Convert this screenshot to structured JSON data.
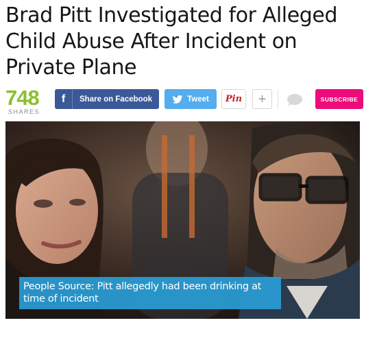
{
  "article": {
    "headline": "Brad Pitt Investigated for Alleged Child Abuse After Incident on Private Plane"
  },
  "share_bar": {
    "count": "748",
    "count_label": "SHARES",
    "facebook_label": "Share on Facebook",
    "facebook_icon": "facebook-f-icon",
    "tweet_label": "Tweet",
    "tweet_icon": "twitter-bird-icon",
    "pin_label": "Pin",
    "plus_label": "+",
    "comment_icon": "comment-bubble-icon",
    "subscribe_label": "SUBSCRIBE",
    "colors": {
      "count": "#8cbf2f",
      "facebook": "#3b5998",
      "twitter": "#55acee",
      "pinterest": "#cb2027",
      "subscribe": "#ec0c7b"
    }
  },
  "video": {
    "caption": "People Source: Pitt allegedly had been drinking at time of incident",
    "caption_color": "#299dd6"
  }
}
